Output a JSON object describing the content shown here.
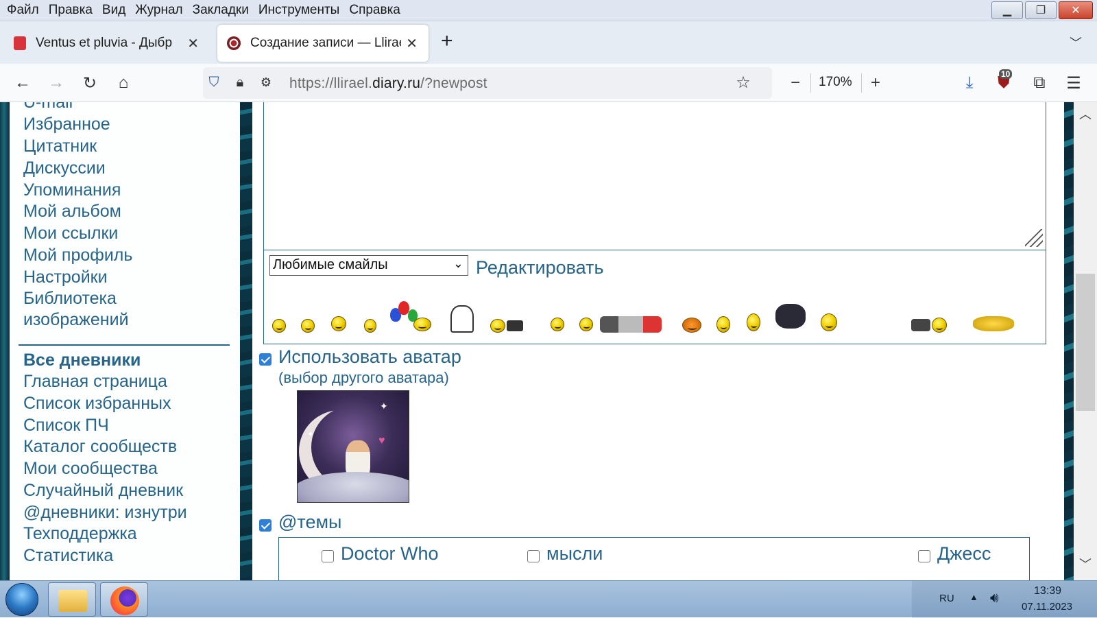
{
  "menubar": {
    "items": [
      "Файл",
      "Правка",
      "Вид",
      "Журнал",
      "Закладки",
      "Инструменты",
      "Справка"
    ]
  },
  "tabs": {
    "inactive_title": "Ventus et pluvia - Дыбр",
    "active_title": "Создание записи — Llirael",
    "close_glyph": "✕",
    "new_tab_glyph": "+"
  },
  "navbar": {
    "url_prefix": "https://llirael.",
    "url_domain": "diary.ru",
    "url_suffix": "/?newpost",
    "zoom": "170%",
    "extension_badge": "10"
  },
  "sidebar": {
    "partial_top_link": "U-mail",
    "personal_links": [
      "Избранное",
      "Цитатник",
      "Дискуссии",
      "Упоминания",
      "Мой альбом",
      "Мои ссылки",
      "Мой профиль",
      "Настройки",
      "Библиотека",
      "изображений"
    ],
    "section_title": "Все дневники",
    "all_links": [
      "Главная страница",
      "Список избранных",
      "Список ПЧ",
      "Каталог сообществ",
      "Мои сообщества",
      "Случайный дневник",
      "@дневники: изнутри",
      "Техподдержка",
      "Статистика"
    ]
  },
  "editor": {
    "smiles_select_value": "Любимые смайлы",
    "edit_link": "Редактировать"
  },
  "avatar": {
    "use_avatar_label": "Использовать аватар",
    "use_avatar_checked": true,
    "choose_other": "(выбор другого аватара)"
  },
  "topics": {
    "label": "@темы",
    "checked": true,
    "items": [
      "Doctor Who",
      "мысли",
      "Джесс"
    ]
  },
  "taskbar": {
    "language": "RU",
    "time": "13:39",
    "date": "07.11.2023"
  },
  "icons": {
    "back": "back-arrow-icon",
    "forward": "forward-arrow-icon",
    "reload": "reload-icon",
    "home": "home-icon",
    "shield": "shield-icon",
    "lock": "lock-icon",
    "bookmark": "star-icon",
    "download": "download-icon",
    "menu": "hamburger-menu-icon"
  },
  "colors": {
    "link": "#27648a",
    "accent": "#2f7fd6"
  }
}
